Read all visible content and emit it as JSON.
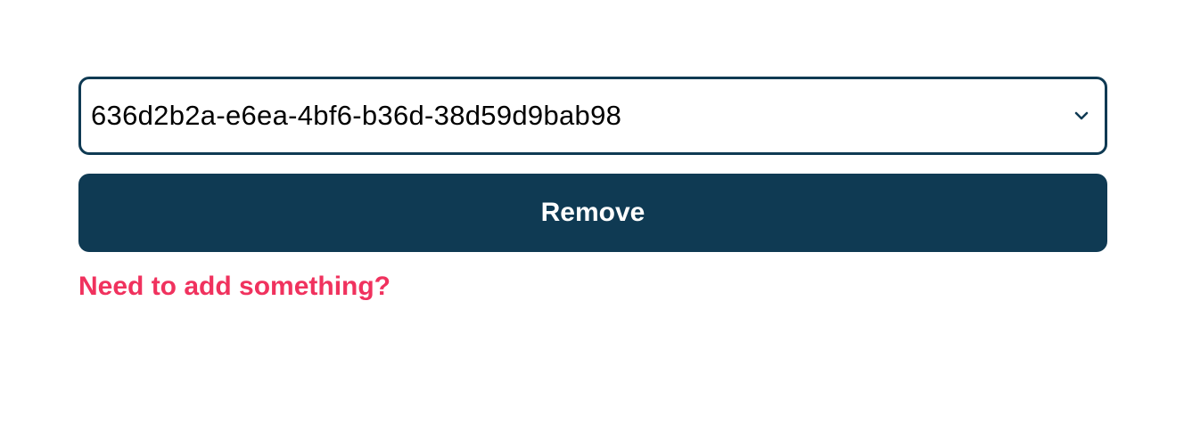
{
  "form": {
    "select": {
      "value": "636d2b2a-e6ea-4bf6-b36d-38d59d9bab98",
      "icon": "chevron-down-icon"
    },
    "remove_button_label": "Remove",
    "add_link_label": "Need to add something?"
  },
  "colors": {
    "primary": "#0f3a53",
    "accent": "#f0325e",
    "background": "#ffffff"
  }
}
